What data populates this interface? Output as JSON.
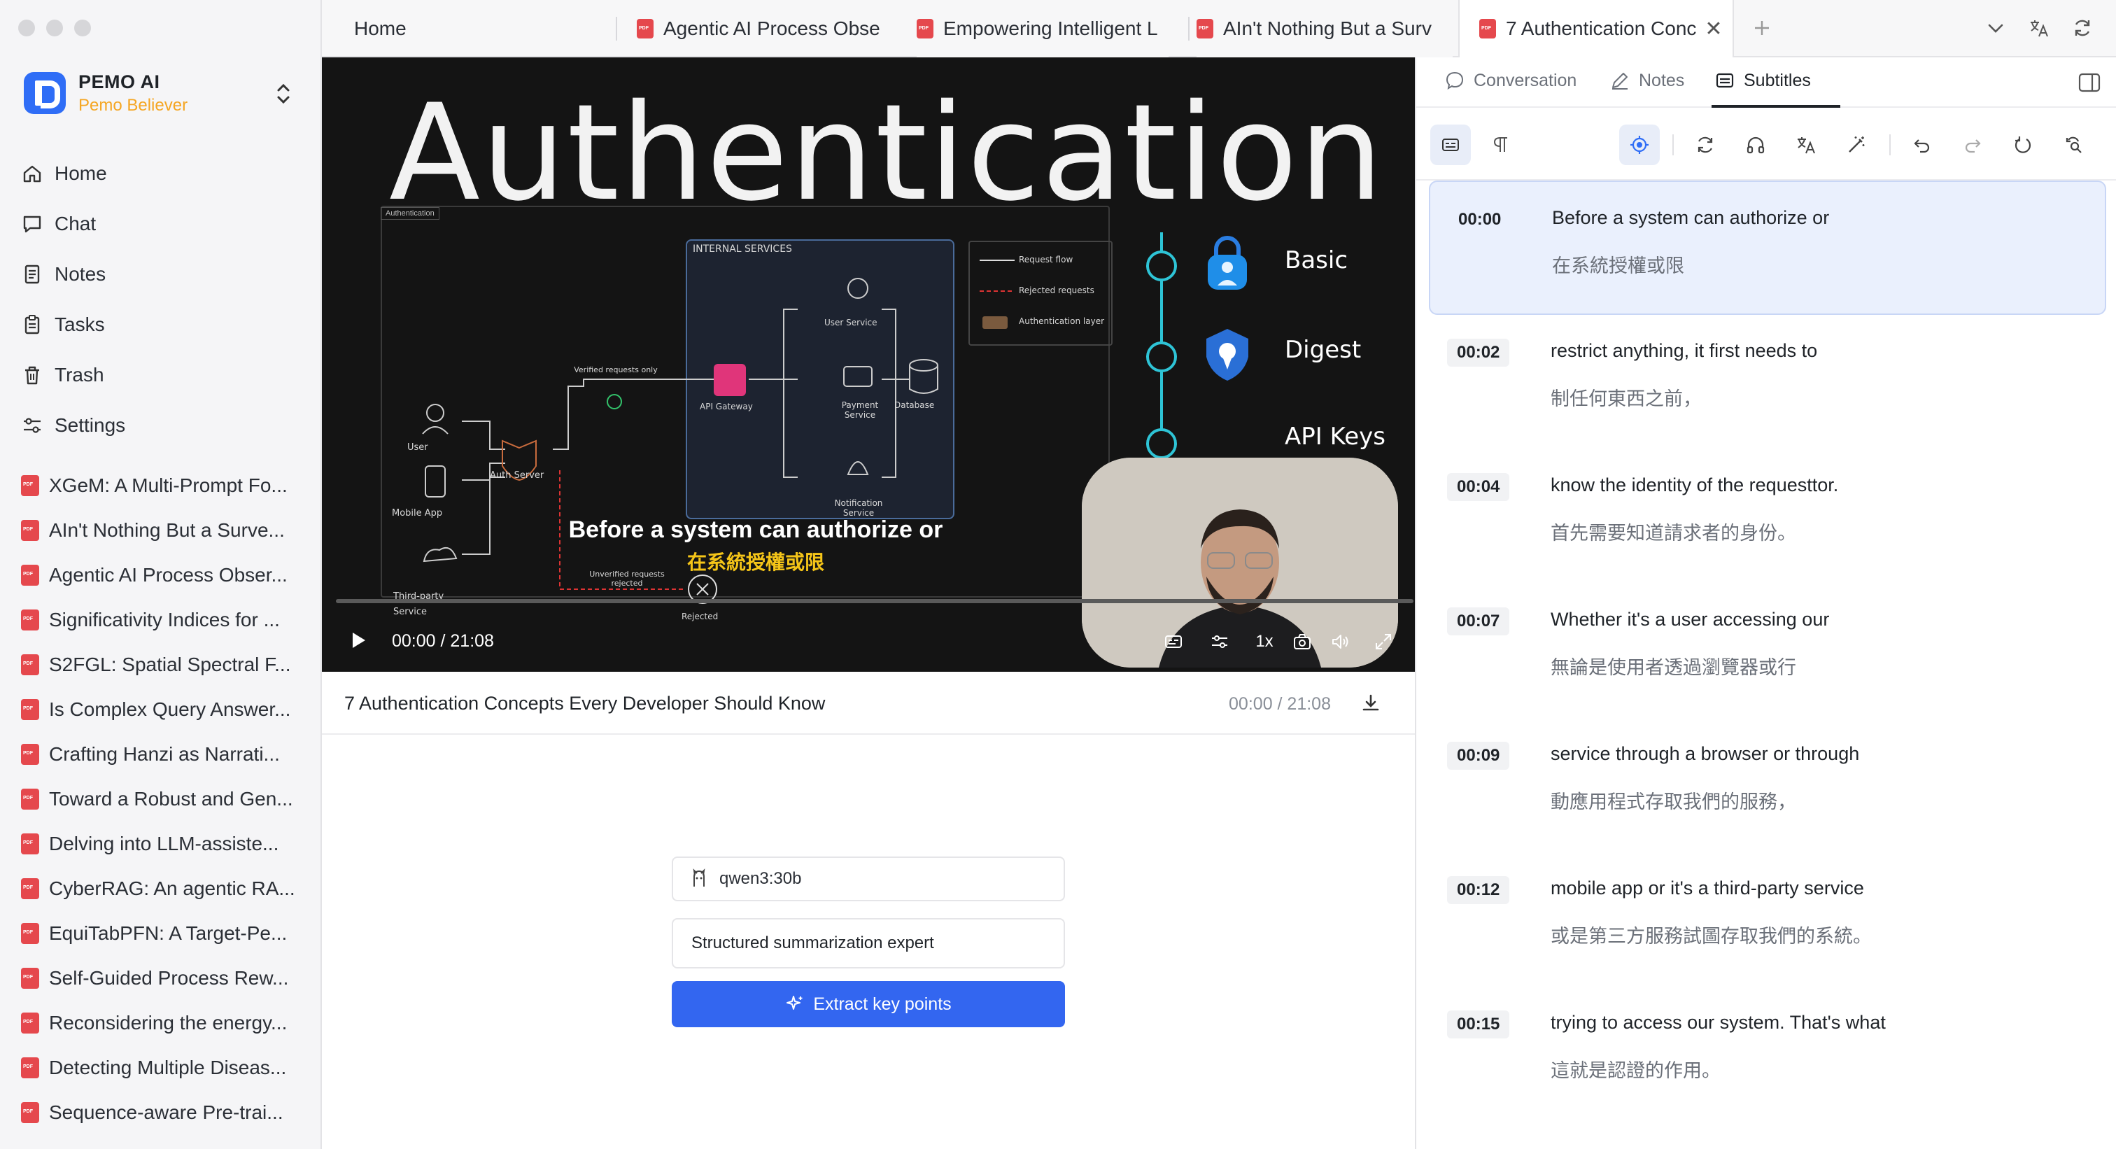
{
  "app": {
    "name": "PEMO AI",
    "subtitle": "Pemo Believer"
  },
  "nav": [
    {
      "label": "Home",
      "icon": "home-icon"
    },
    {
      "label": "Chat",
      "icon": "chat-icon"
    },
    {
      "label": "Notes",
      "icon": "notes-icon"
    },
    {
      "label": "Tasks",
      "icon": "tasks-icon"
    },
    {
      "label": "Trash",
      "icon": "trash-icon"
    },
    {
      "label": "Settings",
      "icon": "settings-icon"
    }
  ],
  "files": [
    "XGeM: A Multi-Prompt Fo...",
    "AIn't Nothing But a Surve...",
    "Agentic AI Process Obser...",
    "Significativity Indices for ...",
    "S2FGL: Spatial Spectral F...",
    "Is Complex Query Answer...",
    "Crafting Hanzi as Narrati...",
    "Toward a Robust and Gen...",
    "Delving into LLM-assiste...",
    "CyberRAG: An agentic RA...",
    "EquiTabPFN: A Target-Pe...",
    "Self-Guided Process Rew...",
    "Reconsidering the energy...",
    "Detecting Multiple Diseas...",
    "Sequence-aware Pre-trai..."
  ],
  "tabs": [
    {
      "label": "Home",
      "pdf": false
    },
    {
      "label": "Agentic AI Process Obse",
      "pdf": true
    },
    {
      "label": "Empowering Intelligent L",
      "pdf": true
    },
    {
      "label": "AIn't Nothing But a Surv",
      "pdf": true
    },
    {
      "label": "7 Authentication Conc",
      "pdf": true,
      "active": true
    }
  ],
  "video": {
    "heading": "Authentication",
    "diagram": {
      "tag": "Authentication",
      "internal_services": "INTERNAL SERVICES",
      "nodes": {
        "user": "User",
        "mobile_app": "Mobile App",
        "third_party": "Third-party Service",
        "auth_server": "Auth Server",
        "verified": "Verified requests only",
        "api_gateway": "API Gateway",
        "user_service": "User Service",
        "payment_service": "Payment Service",
        "database": "Database",
        "notification_service": "Notification Service",
        "unverified": "Unverified requests rejected",
        "rejected": "Rejected"
      },
      "legend": {
        "request_flow": "Request flow",
        "rejected_requests": "Rejected requests",
        "auth_layer": "Authentication layer"
      }
    },
    "auth_methods": [
      "Basic",
      "Digest",
      "API Keys"
    ],
    "caption_en": "Before a system can authorize or",
    "caption_zh": "在系統授權或限",
    "time": "00:00 / 21:08",
    "speed": "1x",
    "progress": 0.0
  },
  "video_info": {
    "title": "7 Authentication Concepts Every Developer Should Know",
    "time": "00:00 / 21:08"
  },
  "summarize": {
    "model": "qwen3:30b",
    "role": "Structured summarization expert",
    "button": "Extract key points"
  },
  "right_tabs": [
    {
      "label": "Conversation",
      "icon": "conversation-icon"
    },
    {
      "label": "Notes",
      "icon": "notes-edit-icon"
    },
    {
      "label": "Subtitles",
      "icon": "subtitles-icon",
      "active": true
    }
  ],
  "subtitles": [
    {
      "time": "00:00",
      "en": "Before a system can authorize or",
      "zh": "在系統授權或限",
      "active": true
    },
    {
      "time": "00:02",
      "en": "restrict anything, it first needs to",
      "zh": "制任何東西之前，"
    },
    {
      "time": "00:04",
      "en": "know the identity of the requesttor.",
      "zh": "首先需要知道請求者的身份。"
    },
    {
      "time": "00:07",
      "en": "Whether it's a user accessing our",
      "zh": "無論是使用者透過瀏覽器或行"
    },
    {
      "time": "00:09",
      "en": "service through a browser or through",
      "zh": "動應用程式存取我們的服務，"
    },
    {
      "time": "00:12",
      "en": "mobile app or it's a third-party service",
      "zh": "或是第三方服務試圖存取我們的系統。"
    },
    {
      "time": "00:15",
      "en": "trying to access our system. That's what",
      "zh": "這就是認證的作用。"
    }
  ]
}
